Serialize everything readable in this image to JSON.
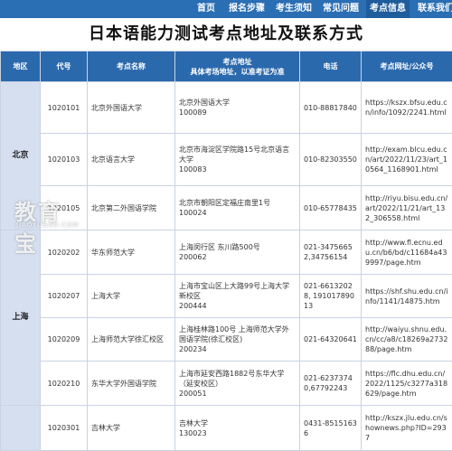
{
  "nav": {
    "items": [
      "首页",
      "报名步骤",
      "考生须知",
      "常见问题",
      "考点信息",
      "联系我们"
    ],
    "active_index": 4
  },
  "title": "日本语能力测试考点地址及联系方式",
  "table": {
    "headers": {
      "region": "地区",
      "code": "代号",
      "name": "考点名称",
      "address_line1": "考点地址",
      "address_line2": "具体考场地址，以准考证为准",
      "phone": "电话",
      "url": "考点网址/公众号"
    },
    "regions": {
      "beijing": "北京",
      "shanghai": "上海"
    },
    "rows": [
      {
        "code": "1020101",
        "name": "北京外国语大学",
        "address": "北京外国语大学\n100089",
        "phone": "010-88817840",
        "url": "https://kszx.bfsu.edu.cn/info/1092/2241.html"
      },
      {
        "code": "1020103",
        "name": "北京语言大学",
        "address": "北京市海淀区学院路15号北京语言大学\n100083",
        "phone": "010-82303550",
        "url": "http://exam.blcu.edu.cn/art/2022/11/23/art_10564_1168901.html"
      },
      {
        "code": "1020105",
        "name": "北京第二外国语学院",
        "address": "北京市朝阳区定福庄南里1号\n100024",
        "phone": "010-65778435",
        "url": "http://riyu.bisu.edu.cn/art/2022/11/21/art_132_306558.html"
      },
      {
        "code": "1020202",
        "name": "华东师范大学",
        "address": "上海闵行区 东川路500号\n200062",
        "phone": "021-34756652,34756154",
        "url": "http://www.fl.ecnu.edu.cn/b6/bd/c11684a439997/page.htm"
      },
      {
        "code": "1020207",
        "name": "上海大学",
        "address": "上海市宝山区上大路99号上海大学新校区\n200444",
        "phone": "021-66132028, 19101789013",
        "url": "https://shf.shu.edu.cn/info/1141/14875.htm"
      },
      {
        "code": "1020209",
        "name": "上海师范大学徐汇校区",
        "address": "上海桂林路100号 上海师范大学外国语学院(徐汇校区)\n200234",
        "phone": "021-64320641",
        "url": "http://waiyu.shnu.edu.cn/cc/a8/c18269a273288/page.htm"
      },
      {
        "code": "1020210",
        "name": "东华大学外国语学院",
        "address": "上海市延安西路1882号东华大学（延安校区）\n200051",
        "phone": "021-62373740,67792243",
        "url": "https://flc.dhu.edu.cn/2022/1125/c3277a318629/page.htm"
      },
      {
        "code": "1020301",
        "name": "吉林大学",
        "address": "吉林大学\n130023",
        "phone": "0431-85151636",
        "url": "http://kszx.jlu.edu.cn/shownews.php?ID=2937"
      }
    ]
  },
  "watermark": {
    "big": "教育宝",
    "small": "JIAOYUBAO.COM"
  },
  "colors": {
    "nav_bg": "#2a6eb3",
    "header_bg": "#2b69ad",
    "region_bg": "#d6dff0",
    "border": "#c9d3e2"
  }
}
